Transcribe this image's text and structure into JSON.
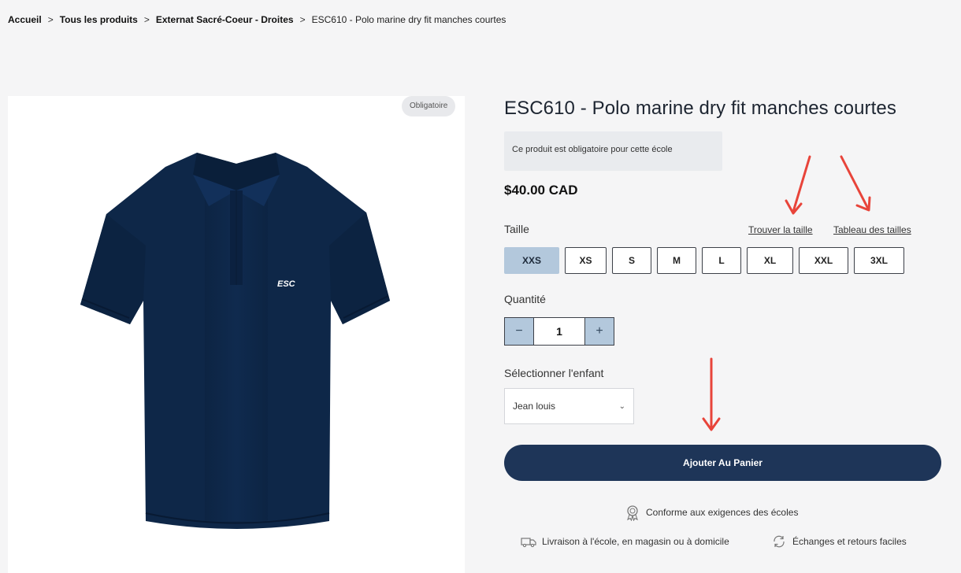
{
  "breadcrumb": {
    "items": [
      "Accueil",
      "Tous les produits",
      "Externat Sacré-Coeur - Droites"
    ],
    "current": "ESC610 - Polo marine dry fit manches courtes",
    "separator": ">"
  },
  "product": {
    "badge": "Obligatoire",
    "logo_text": "ESC",
    "title": "ESC610 - Polo marine dry fit manches courtes",
    "notice": "Ce produit est obligatoire pour cette école",
    "price": "$40.00 CAD",
    "shirt_color": "#0e2748"
  },
  "size": {
    "label": "Taille",
    "find_size_link": "Trouver la taille",
    "size_chart_link": "Tableau des tailles",
    "options": [
      "XXS",
      "XS",
      "S",
      "M",
      "L",
      "XL",
      "XXL",
      "3XL"
    ],
    "selected": "XXS"
  },
  "quantity": {
    "label": "Quantité",
    "minus": "−",
    "value": "1",
    "plus": "+"
  },
  "child": {
    "label": "Sélectionner l'enfant",
    "selected": "Jean louis"
  },
  "cart": {
    "button_label": "Ajouter Au Panier",
    "color": "#1e3558"
  },
  "assurances": {
    "requirements": "Conforme aux exigences des écoles",
    "delivery": "Livraison à l'école, en magasin ou à domicile",
    "returns": "Échanges et retours faciles"
  },
  "annotation": {
    "arrow_color": "#e8443a"
  },
  "icons": [
    "award-icon",
    "truck-icon",
    "exchange-icon",
    "chevron-down-icon"
  ]
}
